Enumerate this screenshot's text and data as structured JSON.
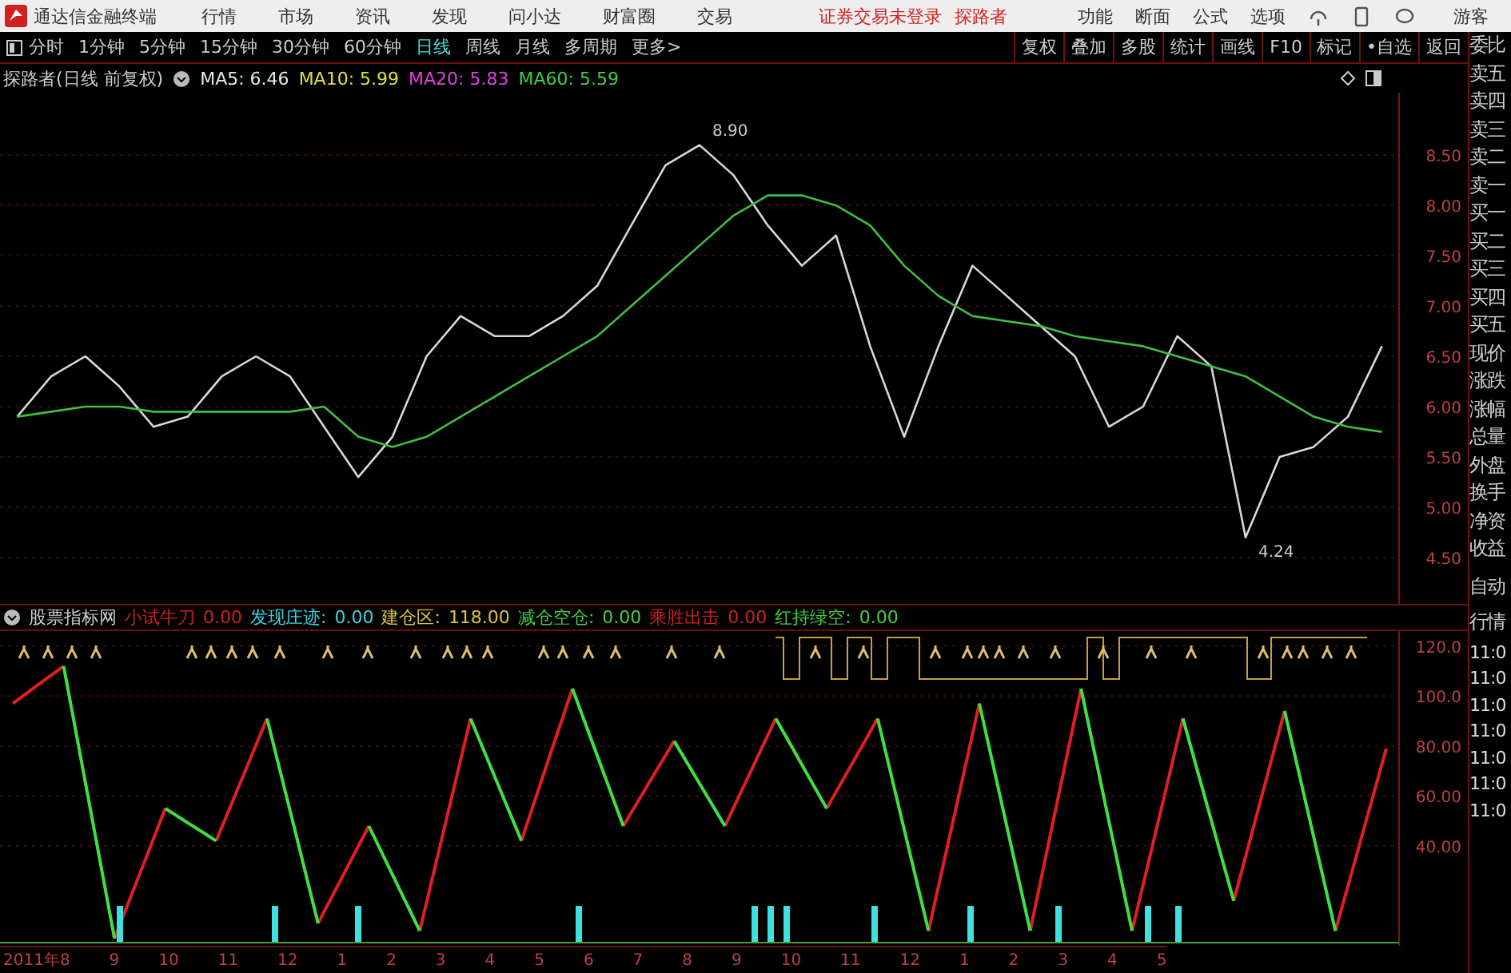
{
  "title_bar": {
    "app_name": "通达信金融终端",
    "menu": [
      "行情",
      "市场",
      "资讯",
      "发现",
      "问小达",
      "财富圈",
      "交易"
    ],
    "login_status": "证券交易未登录",
    "stock_name": "探路者",
    "actions": [
      "功能",
      "断面",
      "公式",
      "选项"
    ],
    "user": "游客"
  },
  "period_tabs": [
    {
      "label": "分时",
      "selected": false
    },
    {
      "label": "1分钟",
      "selected": false
    },
    {
      "label": "5分钟",
      "selected": false
    },
    {
      "label": "15分钟",
      "selected": false
    },
    {
      "label": "30分钟",
      "selected": false
    },
    {
      "label": "60分钟",
      "selected": false
    },
    {
      "label": "日线",
      "selected": true
    },
    {
      "label": "周线",
      "selected": false
    },
    {
      "label": "月线",
      "selected": false
    },
    {
      "label": "多周期",
      "selected": false
    },
    {
      "label": "更多>",
      "selected": false
    }
  ],
  "tool_buttons": [
    "复权",
    "叠加",
    "多股",
    "统计",
    "画线",
    "F10",
    "标记",
    "•自选",
    "返回"
  ],
  "price_panel": {
    "title": "探路者(日线 前复权)",
    "averages": [
      {
        "label": "MA5: 6.46",
        "color": "#e8e8e8"
      },
      {
        "label": "MA10: 5.99",
        "color": "#e0e040"
      },
      {
        "label": "MA20: 5.83",
        "color": "#e040e0"
      },
      {
        "label": "MA60: 5.59",
        "color": "#40d040"
      }
    ],
    "chart_data": {
      "type": "line",
      "grid": true,
      "ylim": [
        4.04,
        9.12
      ],
      "yticks": [
        {
          "value": 8.5,
          "label": "8.50"
        },
        {
          "value": 8,
          "label": "8.00"
        },
        {
          "value": 7.5,
          "label": "7.50"
        },
        {
          "value": 7,
          "label": "7.00"
        },
        {
          "value": 6.5,
          "label": "6.50"
        },
        {
          "value": 6,
          "label": "6.00"
        },
        {
          "value": 5.5,
          "label": "5.50"
        },
        {
          "value": 5,
          "label": "5.00"
        },
        {
          "value": 4.5,
          "label": "4.50"
        }
      ],
      "series": [
        {
          "color": "#d8d8d8",
          "values": [
            5.9,
            6.3,
            6.5,
            6.2,
            5.8,
            5.9,
            6.3,
            6.5,
            6.3,
            5.8,
            5.3,
            5.7,
            6.5,
            6.9,
            6.7,
            6.7,
            6.9,
            7.2,
            7.8,
            8.4,
            8.6,
            8.3,
            7.8,
            7.4,
            7.7,
            6.6,
            5.7,
            6.6,
            7.4,
            7.1,
            6.8,
            6.5,
            5.8,
            6.0,
            6.7,
            6.4,
            4.7,
            5.5,
            5.6,
            5.9,
            6.6
          ]
        },
        {
          "color": "#40c040",
          "values": [
            5.9,
            5.95,
            6.0,
            6.0,
            5.95,
            5.95,
            5.95,
            5.95,
            5.95,
            6.0,
            5.7,
            5.6,
            5.7,
            5.9,
            6.1,
            6.3,
            6.5,
            6.7,
            7.0,
            7.3,
            7.6,
            7.9,
            8.1,
            8.1,
            8.0,
            7.8,
            7.4,
            7.1,
            6.9,
            6.85,
            6.8,
            6.7,
            6.65,
            6.6,
            6.5,
            6.4,
            6.3,
            6.1,
            5.9,
            5.8,
            5.75
          ]
        }
      ],
      "annotations": [
        "8.90",
        "4.24"
      ]
    }
  },
  "indicator_panel": {
    "title": "股票指标网",
    "readouts": [
      {
        "label": "小试牛刀",
        "value": "0.00",
        "color": "#d02020"
      },
      {
        "label": "发现庄迹:",
        "value": "0.00",
        "color": "#40d0e0"
      },
      {
        "label": "建仓区:",
        "value": "118.00",
        "color": "#e0c040"
      },
      {
        "label": "减仓空仓:",
        "value": "0.00",
        "color": "#40d040"
      },
      {
        "label": "乘胜出击",
        "value": "0.00",
        "color": "#d02020"
      },
      {
        "label": "红持绿空:",
        "value": "0.00",
        "color": "#40d040"
      }
    ],
    "chart_data": {
      "type": "line",
      "grid": true,
      "ylim": [
        0,
        126
      ],
      "yticks": [
        {
          "value": 120,
          "label": "120.0"
        },
        {
          "value": 100,
          "label": "100.0"
        },
        {
          "value": 80,
          "label": "80.00"
        },
        {
          "value": 60,
          "label": "60.00"
        },
        {
          "value": 40,
          "label": "40.00"
        }
      ],
      "series": [
        {
          "color": "#e02020",
          "values": [
            97,
            104.5,
            112,
            null,
            3,
            29,
            55,
            null,
            42,
            66.5,
            91,
            null,
            9,
            28.5,
            48,
            null,
            6,
            48.5,
            91,
            null,
            42,
            72.5,
            103,
            null,
            48,
            65,
            82,
            null,
            48,
            69.5,
            91,
            null,
            55,
            73,
            91,
            null,
            6,
            51.5,
            97,
            null,
            6,
            54.5,
            103,
            null,
            6,
            48.5,
            91,
            null,
            18,
            56,
            94,
            null,
            6,
            42.5,
            79
          ]
        },
        {
          "color": "#40e040",
          "values": [
            null,
            null,
            112,
            57.5,
            3,
            null,
            55,
            48.5,
            42,
            null,
            91,
            50,
            9,
            null,
            48,
            27,
            6,
            null,
            91,
            66.5,
            42,
            null,
            103,
            75.5,
            48,
            null,
            82,
            65,
            48,
            null,
            91,
            73,
            55,
            null,
            91,
            48.5,
            6,
            null,
            97,
            51.5,
            6,
            null,
            103,
            54.5,
            6,
            null,
            91,
            54.5,
            18,
            null,
            94,
            50,
            6,
            null,
            null
          ]
        }
      ]
    }
  },
  "date_axis": [
    "2011年8",
    "9",
    "10",
    "11",
    "12",
    "1",
    "2",
    "3",
    "4",
    "5",
    "6",
    "7",
    "8",
    "9",
    "10",
    "11",
    "12",
    "1",
    "2",
    "3",
    "4",
    "5"
  ],
  "quote_panel": {
    "labels": [
      "委比",
      "卖五",
      "卖四",
      "卖三",
      "卖二",
      "卖一",
      "买一",
      "买二",
      "买三",
      "买四",
      "买五",
      "现价",
      "涨跌",
      "涨幅",
      "总量",
      "外盘",
      "换手",
      "净资",
      "收益"
    ],
    "tabs": [
      "自动",
      "行情"
    ],
    "times": [
      "11:0",
      "11:0",
      "11:0",
      "11:0",
      "11:0",
      "11:0",
      "11:0"
    ]
  }
}
